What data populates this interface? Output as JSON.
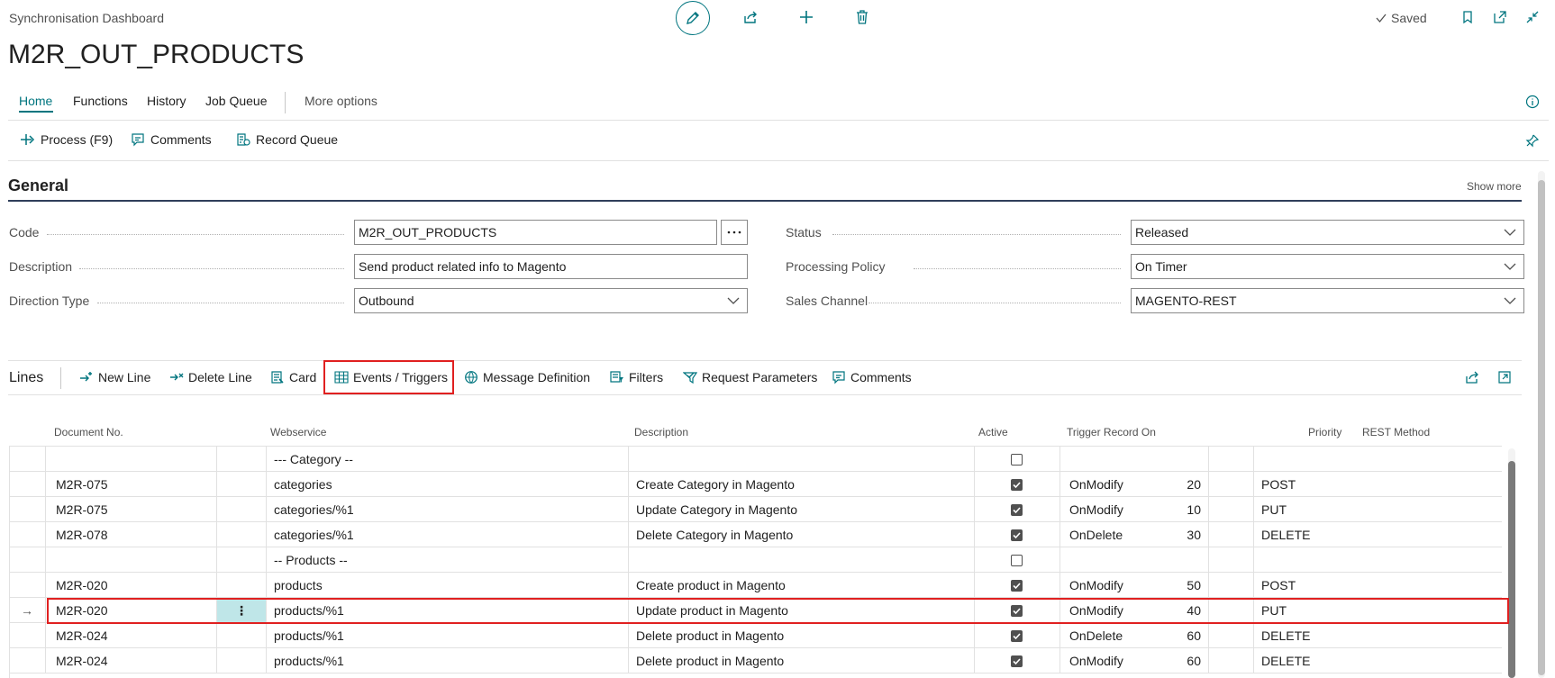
{
  "header": {
    "breadcrumb": "Synchronisation Dashboard",
    "title": "M2R_OUT_PRODUCTS",
    "saved_label": "Saved"
  },
  "tabs": [
    "Home",
    "Functions",
    "History",
    "Job Queue",
    "More options"
  ],
  "actions": {
    "process": "Process (F9)",
    "comments": "Comments",
    "record_queue": "Record Queue"
  },
  "general": {
    "section_title": "General",
    "show_more": "Show more",
    "code_label": "Code",
    "code_value": "M2R_OUT_PRODUCTS",
    "description_label": "Description",
    "description_value": "Send product related info to Magento",
    "direction_label": "Direction Type",
    "direction_value": "Outbound",
    "status_label": "Status",
    "status_value": "Released",
    "policy_label": "Processing Policy",
    "policy_value": "On Timer",
    "channel_label": "Sales Channel",
    "channel_value": "MAGENTO-REST"
  },
  "lines": {
    "title": "Lines",
    "actions": [
      "New Line",
      "Delete Line",
      "Card",
      "Events / Triggers",
      "Message Definition",
      "Filters",
      "Request Parameters",
      "Comments"
    ],
    "columns": {
      "doc": "Document No.",
      "webservice": "Webservice",
      "description": "Description",
      "active": "Active",
      "trigger": "Trigger Record On",
      "priority": "Priority",
      "method": "REST Method"
    },
    "rows": [
      {
        "doc": "",
        "ws": "--- Category --",
        "desc": "",
        "active": false,
        "trigger": "",
        "priority": "",
        "method": ""
      },
      {
        "doc": "M2R-075",
        "ws": "categories",
        "desc": "Create Category in Magento",
        "active": true,
        "trigger": "OnModify",
        "priority": "20",
        "method": "POST"
      },
      {
        "doc": "M2R-075",
        "ws": "categories/%1",
        "desc": "Update Category in Magento",
        "active": true,
        "trigger": "OnModify",
        "priority": "10",
        "method": "PUT"
      },
      {
        "doc": "M2R-078",
        "ws": "categories/%1",
        "desc": "Delete Category in Magento",
        "active": true,
        "trigger": "OnDelete",
        "priority": "30",
        "method": "DELETE"
      },
      {
        "doc": "",
        "ws": "-- Products --",
        "desc": "",
        "active": false,
        "trigger": "",
        "priority": "",
        "method": ""
      },
      {
        "doc": "M2R-020",
        "ws": "products",
        "desc": "Create product in Magento",
        "active": true,
        "trigger": "OnModify",
        "priority": "50",
        "method": "POST"
      },
      {
        "doc": "M2R-020",
        "ws": "products/%1",
        "desc": "Update product in Magento",
        "active": true,
        "trigger": "OnModify",
        "priority": "40",
        "method": "PUT"
      },
      {
        "doc": "M2R-024",
        "ws": "products/%1",
        "desc": "Delete product in Magento",
        "active": true,
        "trigger": "OnDelete",
        "priority": "60",
        "method": "DELETE"
      },
      {
        "doc": "M2R-024",
        "ws": "products/%1",
        "desc": "Delete product in Magento",
        "active": true,
        "trigger": "OnModify",
        "priority": "60",
        "method": "DELETE"
      }
    ]
  },
  "colors": {
    "accent": "#00757f",
    "highlight": "#e02020"
  }
}
